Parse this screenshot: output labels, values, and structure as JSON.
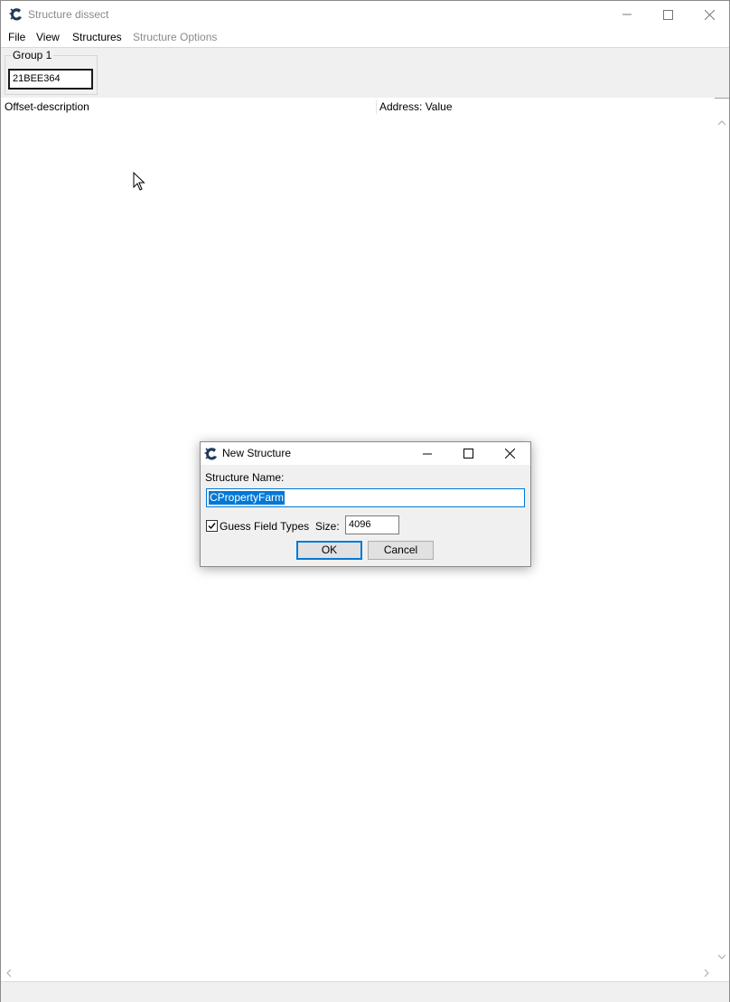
{
  "window": {
    "title": "Structure dissect",
    "icon": "cheat-engine-icon"
  },
  "menubar": {
    "items": [
      "File",
      "View",
      "Structures",
      "Structure Options"
    ]
  },
  "group": {
    "label": "Group 1",
    "address": "21BEE364"
  },
  "columns": {
    "offset": "Offset-description",
    "address": "Address: Value"
  },
  "dialog": {
    "title": "New Structure",
    "name_label": "Structure Name:",
    "name_value": "CPropertyFarm",
    "guess_label": "Guess Field Types",
    "guess_checked": true,
    "size_label": "Size:",
    "size_value": "4096",
    "ok_label": "OK",
    "cancel_label": "Cancel"
  },
  "colors": {
    "accent": "#0078d7",
    "disabled_text": "#8a8a8a",
    "panel": "#f0f0f0"
  }
}
